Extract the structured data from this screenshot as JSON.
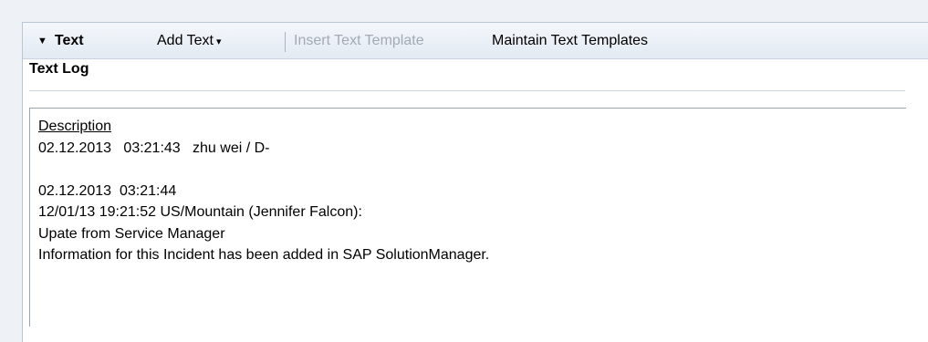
{
  "toolbar": {
    "collapse_label": "Text",
    "add_text_label": "Add Text",
    "insert_template_label": "Insert Text Template",
    "maintain_templates_label": "Maintain Text Templates"
  },
  "section": {
    "title": "Text Log"
  },
  "log": {
    "heading": "Description",
    "entry1": "02.12.2013   03:21:43   zhu wei / D-",
    "entry2_time": "02.12.2013  03:21:44",
    "entry2_line1": "12/01/13 19:21:52 US/Mountain (Jennifer Falcon):",
    "entry2_line2": "Upate from Service Manager",
    "entry2_line3": "Information for this Incident has been added in SAP SolutionManager."
  },
  "colors": {
    "toolbar_bg": "#e3eaf3",
    "disabled_text": "#a3aab3",
    "border": "#9aa5b2"
  }
}
